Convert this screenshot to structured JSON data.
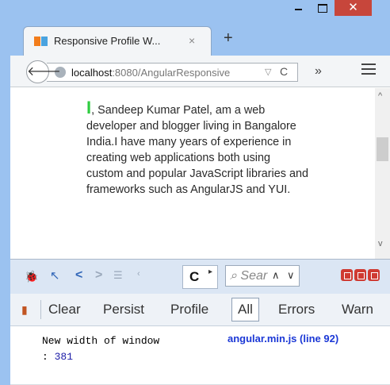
{
  "browser": {
    "tab_title": "Responsive Profile W...",
    "tab_close": "×",
    "new_tab": "+",
    "close_glyph": "✕",
    "url_host": "localhost",
    "url_path": ":8080/AngularResponsive",
    "tab_icon": "firebug-icon"
  },
  "page": {
    "bio_first": "I",
    "bio_text": ", Sandeep Kumar Patel, am a web developer and blogger living in Bangalore India.I have many years of experience in creating web applications both using custom and popular JavaScript libraries and frameworks such as AngularJS and YUI."
  },
  "firebug": {
    "panel_tab": "C",
    "search_placeholder": "Sear",
    "subbar": {
      "clear": "Clear",
      "persist": "Persist",
      "profile": "Profile",
      "all": "All",
      "errors": "Errors",
      "warn": "Warn"
    },
    "log": {
      "message": "New width of window",
      "separator": ":",
      "value": "381",
      "source": "angular.min.js (line 92)"
    }
  },
  "colors": {
    "frame": "#9bc2f0",
    "close_button": "#c7463b",
    "cursor_green": "#2ecc40",
    "log_link": "#1b38d6"
  }
}
